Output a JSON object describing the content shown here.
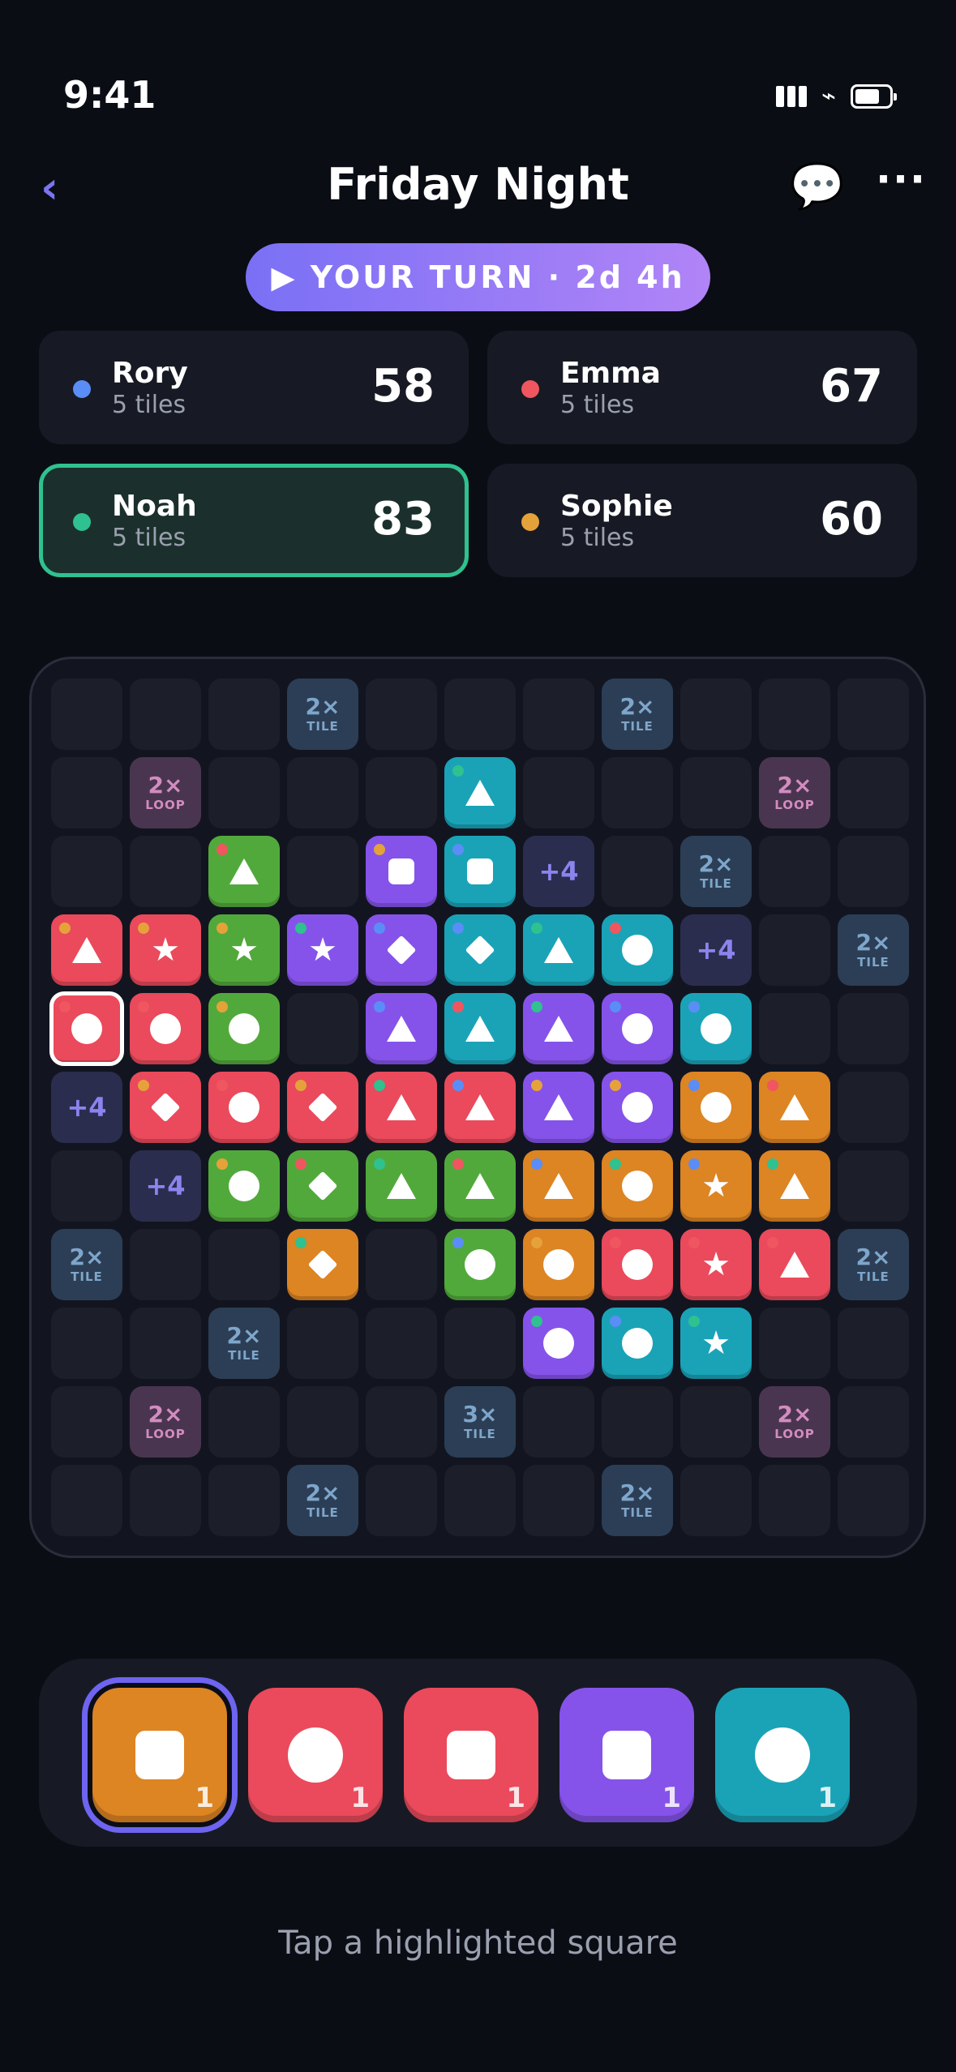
{
  "status": {
    "time": "9:41"
  },
  "header": {
    "title": "Friday Night"
  },
  "turn_banner": {
    "text": "▶ YOUR TURN · 2d 4h"
  },
  "players": [
    {
      "name": "Rory",
      "tiles": "5 tiles",
      "score": "58",
      "color": "#5b8df6",
      "active": false
    },
    {
      "name": "Emma",
      "tiles": "5 tiles",
      "score": "67",
      "color": "#f0565f",
      "active": false
    },
    {
      "name": "Noah",
      "tiles": "5 tiles",
      "score": "83",
      "color": "#2fc18f",
      "active": true
    },
    {
      "name": "Sophie",
      "tiles": "5 tiles",
      "score": "60",
      "color": "#e5a23a",
      "active": false
    }
  ],
  "colors": {
    "red": "#ea4a5b",
    "green": "#52a93b",
    "purple": "#8553ea",
    "teal": "#1aa3b7",
    "orange": "#dd8423",
    "dot_blue": "#5b8df6",
    "dot_red": "#f0565f",
    "dot_green": "#2fc18f",
    "dot_orange": "#e5a23a"
  },
  "bonus_labels": {
    "tile2": {
      "big": "2×",
      "small": "TILE"
    },
    "tile3": {
      "big": "3×",
      "small": "TILE"
    },
    "loop2": {
      "big": "2×",
      "small": "LOOP"
    },
    "plus4": {
      "big": "+4"
    }
  },
  "board": {
    "rows": 11,
    "cols": 11,
    "cells": [
      [
        "",
        "",
        "",
        "B:tile2",
        "",
        "",
        "",
        "B:tile2",
        "",
        "",
        ""
      ],
      [
        "",
        "B:loop2",
        "",
        "",
        "",
        "T:teal:triangle:green",
        "",
        "",
        "",
        "B:loop2",
        ""
      ],
      [
        "",
        "",
        "T:green:triangle:red",
        "",
        "T:purple:square:orange",
        "T:teal:square:blue",
        "B:plus4",
        "",
        "B:tile2",
        "",
        ""
      ],
      [
        "T:red:triangle:orange",
        "T:red:star:orange",
        "T:green:star:orange",
        "T:purple:star:green",
        "T:purple:diamond:blue",
        "T:teal:diamond:blue",
        "T:teal:triangle:green",
        "T:teal:circle:red",
        "B:plus4",
        "",
        "B:tile2"
      ],
      [
        "T:red:circle:red:hl",
        "T:red:circle:red",
        "T:green:circle:orange",
        "",
        "T:purple:triangle:blue",
        "T:teal:triangle:red",
        "T:purple:triangle:green",
        "T:purple:circle:blue",
        "T:teal:circle:blue",
        "",
        ""
      ],
      [
        "B:plus4",
        "T:red:diamond:orange",
        "T:red:circle:red",
        "T:red:diamond:orange",
        "T:red:triangle:green",
        "T:red:triangle:blue",
        "T:purple:triangle:orange",
        "T:purple:circle:orange",
        "T:orange:circle:blue",
        "T:orange:triangle:red",
        ""
      ],
      [
        "",
        "B:plus4",
        "T:green:circle:orange",
        "T:green:diamond:red",
        "T:green:triangle:green",
        "T:green:triangle:red",
        "T:orange:triangle:blue",
        "T:orange:circle:green",
        "T:orange:star:blue",
        "T:orange:triangle:green",
        ""
      ],
      [
        "B:tile2",
        "",
        "",
        "T:orange:diamond:green",
        "",
        "T:green:circle:blue",
        "T:orange:circle:orange",
        "T:red:circle:red",
        "T:red:star:red",
        "T:red:triangle:red",
        "B:tile2"
      ],
      [
        "",
        "",
        "B:tile2",
        "",
        "",
        "",
        "T:purple:circle:green",
        "T:teal:circle:blue",
        "T:teal:star:green",
        "",
        ""
      ],
      [
        "",
        "B:loop2",
        "",
        "",
        "",
        "B:tile3",
        "",
        "",
        "",
        "B:loop2",
        ""
      ],
      [
        "",
        "",
        "",
        "B:tile2",
        "",
        "",
        "",
        "B:tile2",
        "",
        "",
        ""
      ]
    ]
  },
  "rack": [
    {
      "color": "orange",
      "shape": "square",
      "count": "1",
      "selected": true
    },
    {
      "color": "red",
      "shape": "circle",
      "count": "1",
      "selected": false
    },
    {
      "color": "red",
      "shape": "square",
      "count": "1",
      "selected": false
    },
    {
      "color": "purple",
      "shape": "square",
      "count": "1",
      "selected": false
    },
    {
      "color": "teal",
      "shape": "circle",
      "count": "1",
      "selected": false
    }
  ],
  "hint": "Tap a highlighted square"
}
